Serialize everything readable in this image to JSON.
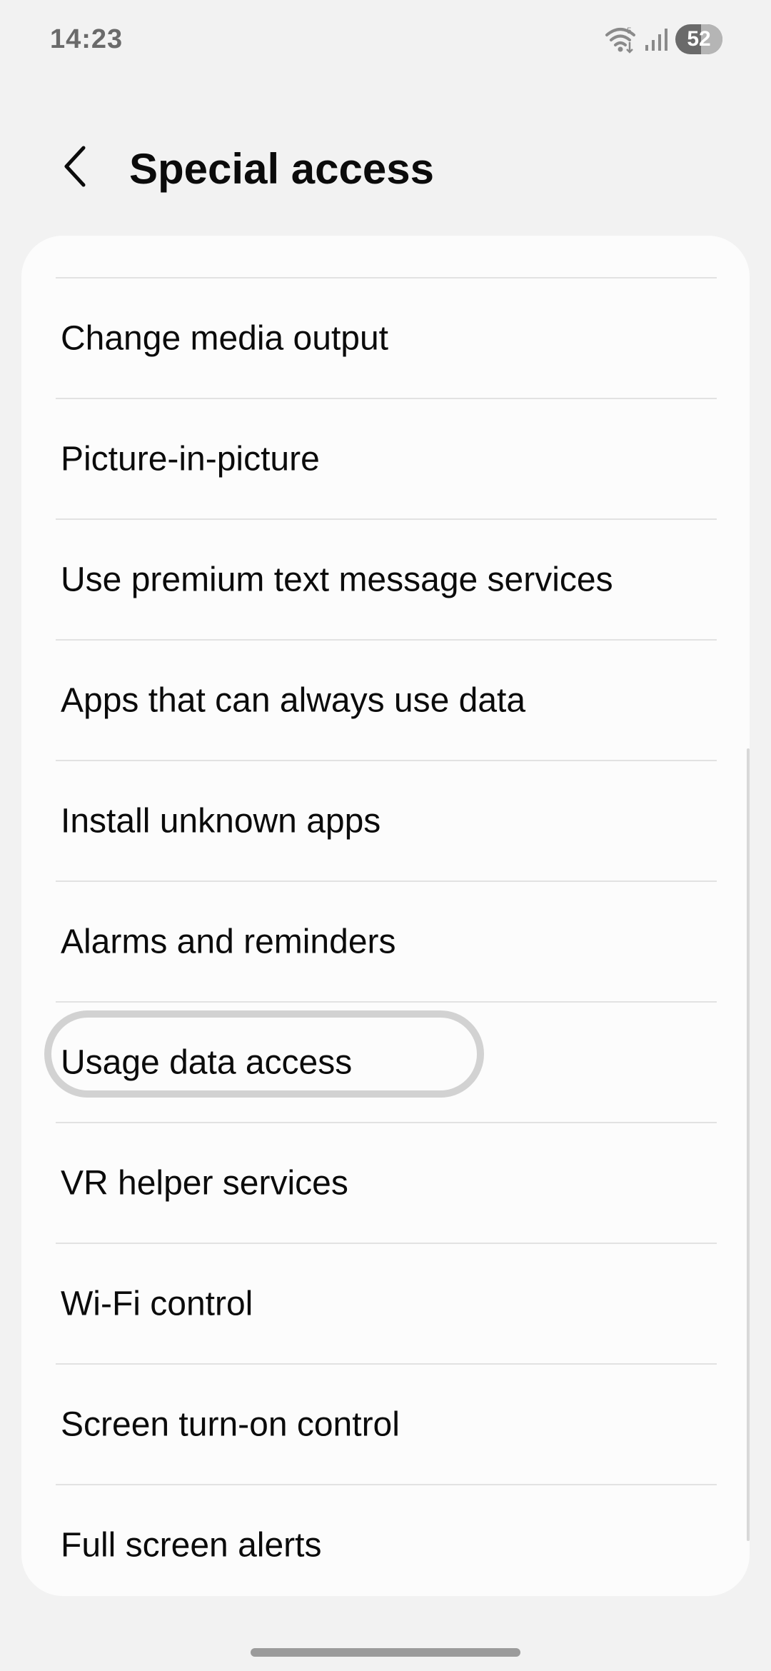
{
  "status_bar": {
    "time": "14:23",
    "battery_level": "52",
    "icons": [
      "wifi-icon",
      "signal-icon",
      "battery-icon"
    ]
  },
  "header": {
    "title": "Special access",
    "back_icon": "chevron-left-icon"
  },
  "list": {
    "items": [
      {
        "label": "Change media output"
      },
      {
        "label": "Picture-in-picture"
      },
      {
        "label": "Use premium text message services"
      },
      {
        "label": "Apps that can always use data"
      },
      {
        "label": "Install unknown apps"
      },
      {
        "label": "Alarms and reminders"
      },
      {
        "label": "Usage data access"
      },
      {
        "label": "VR helper services"
      },
      {
        "label": "Wi-Fi control"
      },
      {
        "label": "Screen turn-on control"
      },
      {
        "label": "Full screen alerts"
      }
    ],
    "highlighted_index": 6
  },
  "colors": {
    "background": "#f2f2f2",
    "card": "#fcfcfc",
    "text": "#0b0b0b",
    "divider": "#e2e2e2",
    "highlight": "#d2d2d2"
  }
}
